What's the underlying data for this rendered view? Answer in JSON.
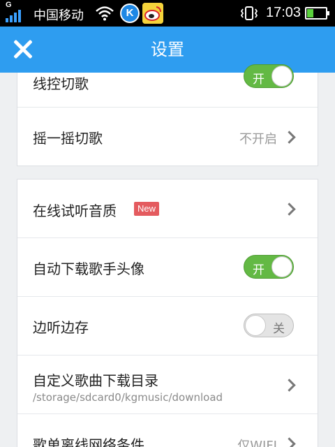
{
  "status_bar": {
    "network_type": "G",
    "carrier": "中国移动",
    "app_icons": [
      "kugou-icon",
      "weibo-icon"
    ],
    "kugou_letter": "K",
    "time": "17:03",
    "battery_level": 0.35
  },
  "header": {
    "title": "设置",
    "close_icon": "close-icon",
    "color": "#2e9df0"
  },
  "settings": {
    "line_control": {
      "label": "线控切歌",
      "toggle": "开",
      "on": true
    },
    "shake": {
      "label": "摇一摇切歌",
      "value": "不开启"
    },
    "online_quality": {
      "label": "在线试听音质",
      "badge": "New"
    },
    "auto_download_avatar": {
      "label": "自动下载歌手头像",
      "toggle": "开",
      "on": true
    },
    "listen_save": {
      "label": "边听边存",
      "toggle": "关",
      "on": false
    },
    "download_dir": {
      "label": "自定义歌曲下载目录",
      "path": "/storage/sdcard0/kgmusic/download"
    },
    "playlist_offline": {
      "label": "歌单离线网络条件",
      "value": "仅WIFI"
    }
  },
  "colors": {
    "toggle_on": "#63b944",
    "badge": "#e45b5f"
  }
}
